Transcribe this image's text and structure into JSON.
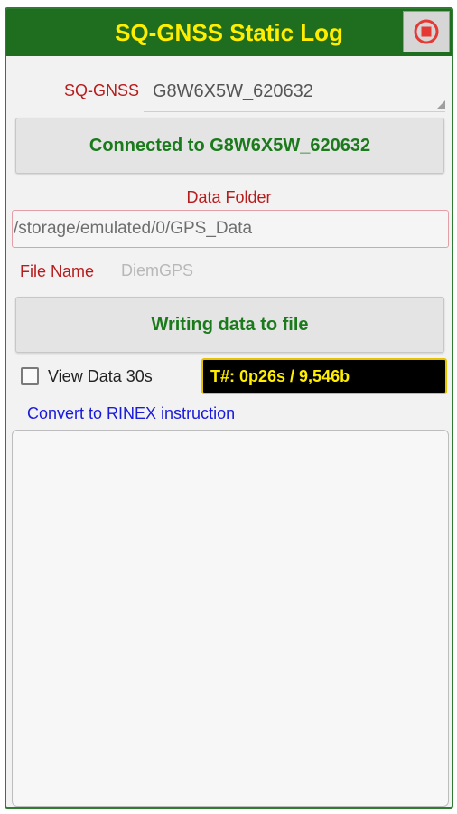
{
  "header": {
    "title": "SQ-GNSS Static Log",
    "stop_icon": "stop-record-icon",
    "bar_color": "#1f6e1f",
    "title_color": "#ffee00",
    "stop_color": "#e53935"
  },
  "device": {
    "label": "SQ-GNSS",
    "selected": "G8W6X5W_620632"
  },
  "connect_button": {
    "label": "Connected to G8W6X5W_620632"
  },
  "folder": {
    "label": "Data Folder",
    "value": "/storage/emulated/0/GPS_Data"
  },
  "file": {
    "label": "File Name",
    "placeholder": "DiemGPS"
  },
  "write_button": {
    "label": "Writing data to file"
  },
  "view_data": {
    "label": "View Data 30s",
    "checked": false
  },
  "status": {
    "text": "T#: 0p26s / 9,546b"
  },
  "rinex_link": {
    "label": "Convert to RINEX instruction"
  },
  "colors": {
    "label_red": "#b71c1c",
    "button_text_green": "#1b7a1b",
    "link_blue": "#1a1adb"
  }
}
